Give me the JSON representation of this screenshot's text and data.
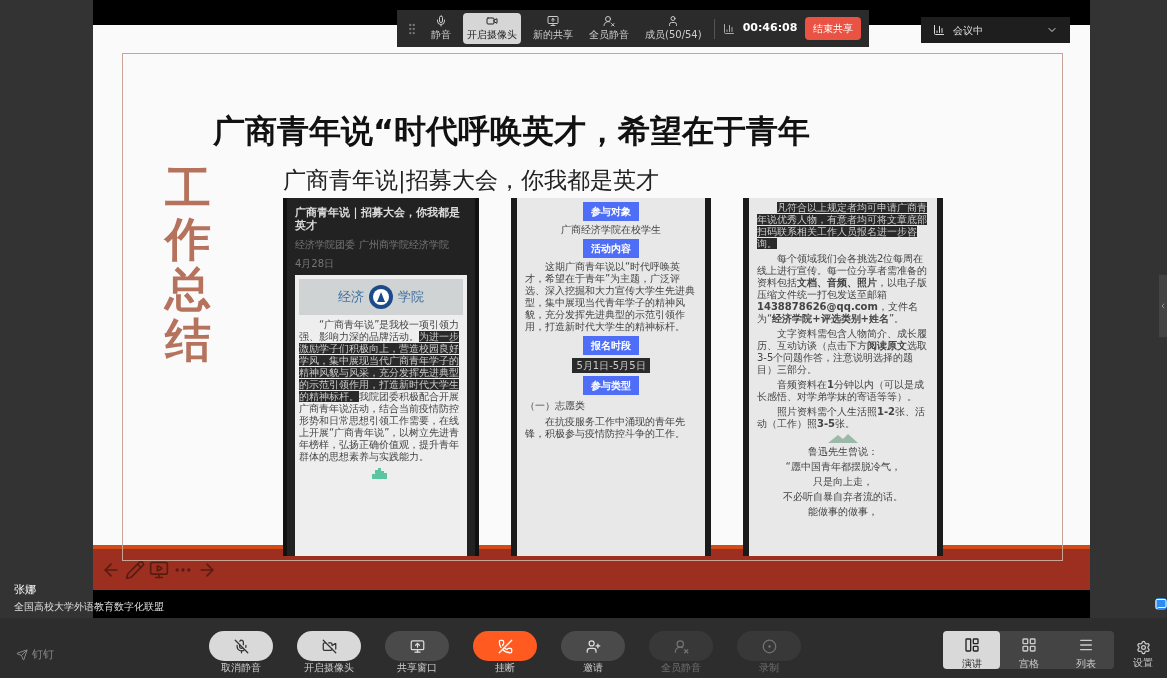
{
  "share_toolbar": {
    "items": [
      {
        "kind": "mic",
        "label": "静音",
        "selected": false
      },
      {
        "kind": "camera",
        "label": "开启摄像头",
        "selected": true
      },
      {
        "kind": "share",
        "label": "新的共享",
        "selected": false
      },
      {
        "kind": "mute-all",
        "label": "全员静音",
        "selected": false
      },
      {
        "kind": "members",
        "label": "成员(50/54)",
        "selected": false
      }
    ],
    "timer": "00:46:08",
    "end_button": "结束共享"
  },
  "status_dropdown": {
    "label": "会议中"
  },
  "slide": {
    "title": "广商青年说“时代呼唤英才，希望在于青年",
    "subtitle": "广商青年说|招募大会，你我都是英才",
    "side_label": "工作总结",
    "screenshots": [
      {
        "kind": "article",
        "title": "广商青年说｜招募大会，你我都是英才",
        "meta": [
          "经济学院团委",
          "广州商学院经济学院",
          "4月28日"
        ],
        "banner": [
          "经济",
          "学院"
        ],
        "blocks": [
          {
            "kind": "paragraph",
            "parts": [
              {
                "text": "“广商青年说”是我校一项引领力强、影响力深的品牌活动。",
                "highlighted": false
              },
              {
                "text": "为进一步激励学子们积极向上，营造校园良好学风，集中展现当代广商青年学子的精神风貌与风采，充分发挥先进典型的示范引领作用，打造新时代大学生的精神标杆。",
                "highlighted": true
              },
              {
                "text": "我院团委积极配合开展广商青年说活动，结合当前疫情防控形势和日常思想引领工作需要，在线上开展“广商青年说”，以树立先进青年榜样，弘扬正确价值观，提升青年群体的思想素养与实践能力。",
                "highlighted": false
              }
            ]
          }
        ]
      },
      {
        "kind": "page",
        "blocks": [
          {
            "kind": "heading",
            "text": "参与对象"
          },
          {
            "kind": "center",
            "text": "广商经济学院在校学生"
          },
          {
            "kind": "heading",
            "text": "活动内容"
          },
          {
            "kind": "paragraph",
            "parts": [
              {
                "text": "这期广商青年说以“时代呼唤英才，希望在于青年”为主题，广泛评选、深入挖掘和大力宣传大学生先进典型，集中展现当代青年学子的精神风貌，充分发挥先进典型的示范引领作用，打造新时代大学生的精神标杆。",
                "highlighted": false
              }
            ]
          },
          {
            "kind": "heading",
            "text": "报名时段"
          },
          {
            "kind": "center-highlight",
            "text": "5月1日-5月5日"
          },
          {
            "kind": "heading",
            "text": "参与类型"
          },
          {
            "kind": "left",
            "text": "（一）志愿类"
          },
          {
            "kind": "paragraph",
            "parts": [
              {
                "text": "在抗疫服务工作中涌现的青年先锋，积极参与疫情防控斗争的工作。",
                "highlighted": false
              }
            ]
          }
        ]
      },
      {
        "kind": "page",
        "blocks": [
          {
            "kind": "paragraph",
            "parts": [
              {
                "text": "凡符合以上规定者均可申请广商青年说优秀人物，有意者均可将文章底部扫码联系相关工作人员报名进一步咨询。",
                "highlighted": true
              }
            ]
          },
          {
            "kind": "paragraph",
            "parts": [
              {
                "text": "每个领域我们会各挑选2位每周在线上进行宣传。每一位分享者需准备的资料包括**文档、音频、照片**，以电子版压缩文件统一打包发送至邮箱**1438878626@qq.com**，文件名为“**经济学院+评选类别+姓名**”。",
                "highlighted": false
              }
            ]
          },
          {
            "kind": "paragraph",
            "parts": [
              {
                "text": "文字资料需包含人物简介、成长履历、互动访谈（点击下方**阅读原文**选取3-5个问题作答，注意说明选择的题目）三部分。",
                "highlighted": false
              }
            ]
          },
          {
            "kind": "paragraph",
            "parts": [
              {
                "text": "音频资料在**1**分钟以内（可以是成长感悟、对学弟学妹的寄语等等）。",
                "highlighted": false
              }
            ]
          },
          {
            "kind": "paragraph",
            "parts": [
              {
                "text": "照片资料需个人生活照**1-2**张、活动（工作）照**3-5**张。",
                "highlighted": false
              }
            ]
          },
          {
            "kind": "divider"
          },
          {
            "kind": "center",
            "text": "鲁迅先生曾说："
          },
          {
            "kind": "center",
            "text": "“愿中国青年都摆脱冷气，"
          },
          {
            "kind": "center",
            "text": "只是向上走，"
          },
          {
            "kind": "center",
            "text": "不必听自暴自弃者流的话。"
          },
          {
            "kind": "center",
            "text": "能做事的做事，"
          }
        ]
      }
    ]
  },
  "speaker": {
    "name": "张娜",
    "organization": "全国高校大学外语教育数字化联盟"
  },
  "app_logo": "钉钉",
  "controls": [
    {
      "kind": "unmute",
      "label": "取消静音",
      "disabled": false
    },
    {
      "kind": "camera",
      "label": "开启摄像头",
      "disabled": false
    },
    {
      "kind": "share",
      "label": "共享窗口",
      "disabled": false
    },
    {
      "kind": "hangup",
      "label": "挂断",
      "disabled": false
    },
    {
      "kind": "invite",
      "label": "邀请",
      "disabled": false
    },
    {
      "kind": "mute-all",
      "label": "全员静音",
      "disabled": true
    },
    {
      "kind": "record",
      "label": "录制",
      "disabled": true
    }
  ],
  "layouts": [
    {
      "kind": "speaker",
      "label": "演讲",
      "selected": true
    },
    {
      "kind": "grid",
      "label": "宫格",
      "selected": false
    },
    {
      "kind": "list",
      "label": "列表",
      "selected": false
    }
  ],
  "settings": {
    "label": "设置"
  }
}
